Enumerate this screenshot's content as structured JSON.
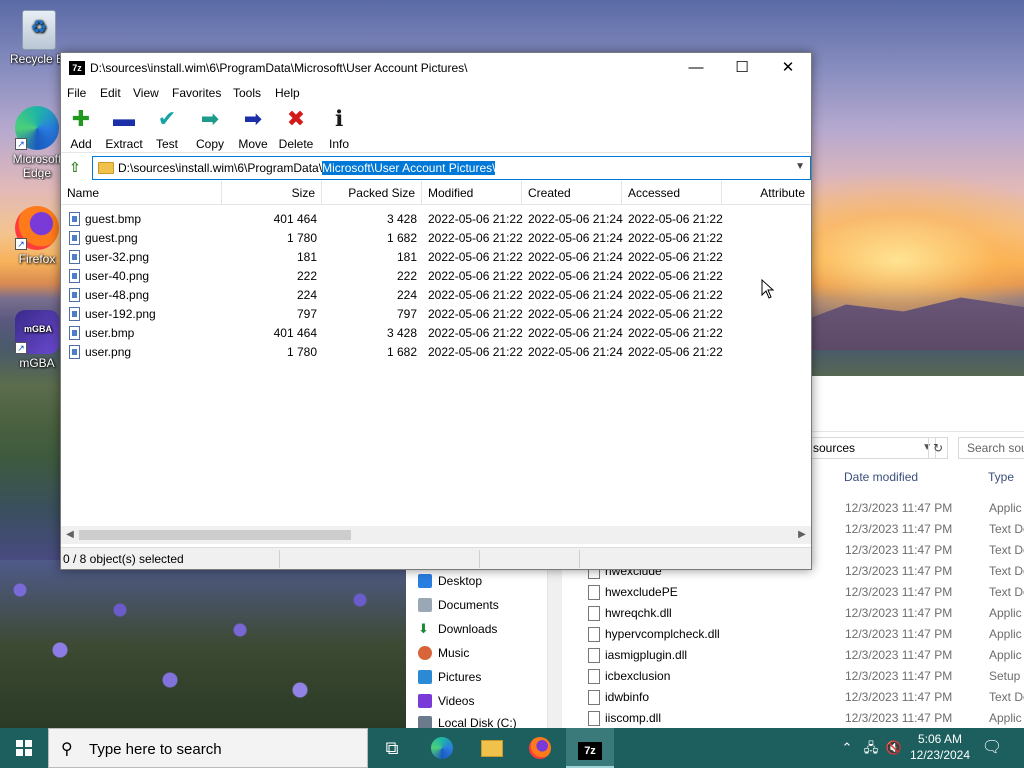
{
  "desktop": {
    "icons": [
      {
        "label": "Recycle Bin",
        "icon": "recycle-bin-icon"
      },
      {
        "label": "Microsoft Edge",
        "icon": "edge-icon"
      },
      {
        "label": "Firefox",
        "icon": "firefox-icon"
      },
      {
        "label": "mGBA",
        "icon": "mgba-icon"
      }
    ]
  },
  "explorer": {
    "address": "sources",
    "search_placeholder": "Search sou",
    "columns": {
      "date": "Date modified",
      "type": "Type"
    },
    "nav": [
      "Desktop",
      "Documents",
      "Downloads",
      "Music",
      "Pictures",
      "Videos",
      "Local Disk (C:)"
    ],
    "rows": [
      {
        "name": "",
        "date": "12/3/2023 11:47 PM",
        "type": "Applic"
      },
      {
        "name": "",
        "date": "12/3/2023 11:47 PM",
        "type": "Text Do"
      },
      {
        "name": "",
        "date": "12/3/2023 11:47 PM",
        "type": "Text Do"
      },
      {
        "name": "hwexclude",
        "date": "12/3/2023 11:47 PM",
        "type": "Text Do"
      },
      {
        "name": "hwexcludePE",
        "date": "12/3/2023 11:47 PM",
        "type": "Text Do"
      },
      {
        "name": "hwreqchk.dll",
        "date": "12/3/2023 11:47 PM",
        "type": "Applic"
      },
      {
        "name": "hypervcomplcheck.dll",
        "date": "12/3/2023 11:47 PM",
        "type": "Applic"
      },
      {
        "name": "iasmigplugin.dll",
        "date": "12/3/2023 11:47 PM",
        "type": "Applic"
      },
      {
        "name": "icbexclusion",
        "date": "12/3/2023 11:47 PM",
        "type": "Setup I"
      },
      {
        "name": "idwbinfo",
        "date": "12/3/2023 11:47 PM",
        "type": "Text Do"
      },
      {
        "name": "iiscomp.dll",
        "date": "12/3/2023 11:47 PM",
        "type": "Applic"
      }
    ]
  },
  "zip": {
    "title": "D:\\sources\\install.wim\\6\\ProgramData\\Microsoft\\User Account Pictures\\",
    "app_icon_text": "7z",
    "menu": [
      "File",
      "Edit",
      "View",
      "Favorites",
      "Tools",
      "Help"
    ],
    "toolbar": [
      {
        "label": "Add",
        "icon": "add-icon",
        "glyph": "✚",
        "color": "#1f9a1f"
      },
      {
        "label": "Extract",
        "icon": "extract-icon",
        "glyph": "▬",
        "color": "#1a2fa8"
      },
      {
        "label": "Test",
        "icon": "test-icon",
        "glyph": "✔",
        "color": "#1aa3a3"
      },
      {
        "label": "Copy",
        "icon": "copy-icon",
        "glyph": "➡",
        "color": "#1c9a8a"
      },
      {
        "label": "Move",
        "icon": "move-icon",
        "glyph": "➡",
        "color": "#1a2fa8"
      },
      {
        "label": "Delete",
        "icon": "delete-icon",
        "glyph": "✖",
        "color": "#d21a1a"
      },
      {
        "label": "Info",
        "icon": "info-icon",
        "glyph": "ℹ",
        "color": "#1a1a1a"
      }
    ],
    "path_prefix": "D:\\sources\\install.wim\\6\\ProgramData\\",
    "path_selected": "Microsoft\\User Account Pictures\\",
    "columns": [
      "Name",
      "Size",
      "Packed Size",
      "Modified",
      "Created",
      "Accessed",
      "Attribute"
    ],
    "files": [
      {
        "name": "guest.bmp",
        "size": "401 464",
        "packed": "3 428",
        "modified": "2022-05-06 21:22",
        "created": "2022-05-06 21:24",
        "accessed": "2022-05-06 21:22"
      },
      {
        "name": "guest.png",
        "size": "1 780",
        "packed": "1 682",
        "modified": "2022-05-06 21:22",
        "created": "2022-05-06 21:24",
        "accessed": "2022-05-06 21:22"
      },
      {
        "name": "user-32.png",
        "size": "181",
        "packed": "181",
        "modified": "2022-05-06 21:22",
        "created": "2022-05-06 21:24",
        "accessed": "2022-05-06 21:22"
      },
      {
        "name": "user-40.png",
        "size": "222",
        "packed": "222",
        "modified": "2022-05-06 21:22",
        "created": "2022-05-06 21:24",
        "accessed": "2022-05-06 21:22"
      },
      {
        "name": "user-48.png",
        "size": "224",
        "packed": "224",
        "modified": "2022-05-06 21:22",
        "created": "2022-05-06 21:24",
        "accessed": "2022-05-06 21:22"
      },
      {
        "name": "user-192.png",
        "size": "797",
        "packed": "797",
        "modified": "2022-05-06 21:22",
        "created": "2022-05-06 21:24",
        "accessed": "2022-05-06 21:22"
      },
      {
        "name": "user.bmp",
        "size": "401 464",
        "packed": "3 428",
        "modified": "2022-05-06 21:22",
        "created": "2022-05-06 21:24",
        "accessed": "2022-05-06 21:22"
      },
      {
        "name": "user.png",
        "size": "1 780",
        "packed": "1 682",
        "modified": "2022-05-06 21:22",
        "created": "2022-05-06 21:24",
        "accessed": "2022-05-06 21:22"
      }
    ],
    "status": "0 / 8 object(s) selected"
  },
  "taskbar": {
    "search_placeholder": "Type here to search",
    "apps": [
      "task-view-icon",
      "edge-icon",
      "file-explorer-icon",
      "firefox-icon",
      "7zip-icon"
    ],
    "active_app_label": "7z",
    "time": "5:06 AM",
    "date": "12/23/2024"
  }
}
